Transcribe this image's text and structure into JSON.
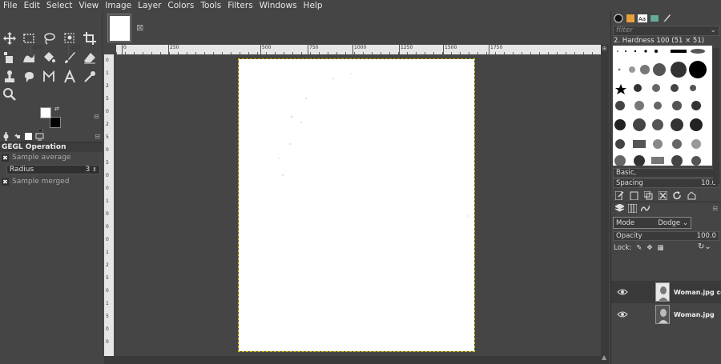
{
  "menubar": {
    "items": [
      "File",
      "Edit",
      "Select",
      "View",
      "Image",
      "Layer",
      "Colors",
      "Tools",
      "Filters",
      "Windows",
      "Help"
    ]
  },
  "toolbox": {
    "tools": [
      {
        "name": "move-tool-icon"
      },
      {
        "name": "rect-select-icon"
      },
      {
        "name": "free-select-icon"
      },
      {
        "name": "fuzzy-select-icon"
      },
      {
        "name": "crop-icon"
      },
      {
        "name": "unified-transform-icon"
      },
      {
        "name": "warp-transform-icon"
      },
      {
        "name": "bucket-fill-icon"
      },
      {
        "name": "paintbrush-icon"
      },
      {
        "name": "eraser-icon"
      },
      {
        "name": "clone-icon"
      },
      {
        "name": "smudge-icon"
      },
      {
        "name": "paths-icon"
      },
      {
        "name": "text-tool-icon"
      },
      {
        "name": "color-picker-icon"
      },
      {
        "name": "zoom-icon"
      }
    ],
    "colors": {
      "foreground": "#ffffff",
      "background": "#000000"
    }
  },
  "tool_options": {
    "title": "GEGL Operation",
    "sample_average": "Sample average",
    "radius_label": "Radius",
    "radius_value": "3",
    "sample_merged": "Sample merged"
  },
  "rulers": {
    "horizontal": [
      "-500",
      "-250",
      "0",
      "250",
      "500",
      "750",
      "1000",
      "1250",
      "1500",
      "1750"
    ],
    "vertical": [
      "0",
      "1",
      "2",
      "5",
      "0",
      "2",
      "5",
      "0",
      "5",
      "0",
      "0",
      "1",
      "0",
      "0",
      "0",
      "1",
      "2",
      "5",
      "0",
      "1",
      "5",
      "0",
      "0"
    ]
  },
  "brushes": {
    "filter_placeholder": "filter",
    "selected": "2. Hardness 100 (51 × 51)",
    "preset": "Basic,",
    "spacing_label": "Spacing",
    "spacing_value": "10.0"
  },
  "layers": {
    "mode_label": "Mode",
    "mode_value": "Dodge",
    "opacity_label": "Opacity",
    "opacity_value": "100.0",
    "lock_label": "Lock:",
    "items": [
      {
        "name": "Woman.jpg copy"
      },
      {
        "name": "Woman.jpg"
      }
    ]
  },
  "colors": {
    "canvas_bg": "#454545",
    "page": "#ffffff",
    "selection_border": "#c8b400"
  }
}
